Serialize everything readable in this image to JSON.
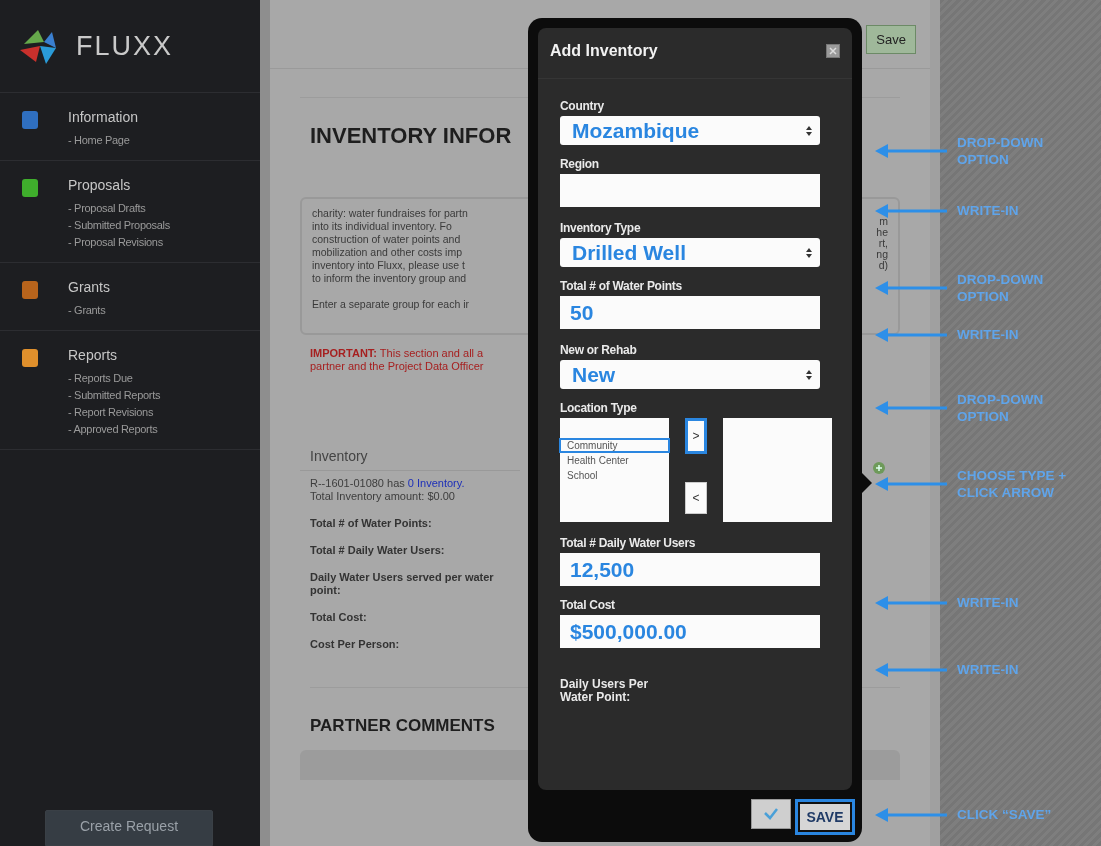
{
  "sidebar": {
    "logo_text": "FLUXX",
    "sections": [
      {
        "title": "Information",
        "color": "#2f6fc0",
        "items": [
          "- Home Page"
        ]
      },
      {
        "title": "Proposals",
        "color": "#3fae2c",
        "items": [
          "- Proposal Drafts",
          "- Submitted Proposals",
          "- Proposal Revisions"
        ]
      },
      {
        "title": "Grants",
        "color": "#b8641c",
        "items": [
          "- Grants"
        ]
      },
      {
        "title": "Reports",
        "color": "#e0902c",
        "items": [
          "- Reports Due",
          "- Submitted Reports",
          "- Report Revisions",
          "- Approved Reports"
        ]
      }
    ],
    "create_button": "Create Request"
  },
  "main": {
    "save_button": "Save",
    "heading": "INVENTORY INFOR",
    "intro_lines": [
      "charity: water fundraises for partn",
      "into its individual inventory. Fo",
      "construction of water points and",
      "mobilization and other costs imp",
      "inventory into Fluxx, please use t",
      "to inform the inventory group and"
    ],
    "intro_last": "Enter a separate group for each ir",
    "intro_edge": [
      "m",
      "he",
      "rt,",
      "ng",
      "d)"
    ],
    "important_lines": [
      "**IMPORTANT:** This section and all a",
      "partner and the Project Data Officer"
    ],
    "inventory_header": "Inventory",
    "record_text": "R--1601-01080 has",
    "record_link": "0 Inventory.",
    "amount_text": "Total Inventory amount: $0.00",
    "summary_labels": [
      "Total # of Water Points:",
      "Total # Daily Water Users:",
      "Daily Water Users served per water point:",
      "Total Cost:",
      "Cost Per Person:"
    ],
    "comments_heading": "PARTNER COMMENTS"
  },
  "modal": {
    "title": "Add Inventory",
    "fields": [
      {
        "kind": "select",
        "label": "Country",
        "value": "Mozambique"
      },
      {
        "kind": "text",
        "label": "Region"
      },
      {
        "kind": "select",
        "label": "Inventory Type",
        "value": "Drilled Well"
      },
      {
        "kind": "text",
        "label": "Total # of Water Points",
        "value": "50"
      },
      {
        "kind": "select",
        "label": "New or Rehab",
        "value": "New"
      },
      {
        "kind": "dual_list",
        "label": "Location Type",
        "options": [
          {
            "label": "Community",
            "selected": true
          },
          {
            "label": "Health Center",
            "selected": false
          },
          {
            "label": "School",
            "selected": false
          }
        ],
        "add_button": ">",
        "remove_button": "<"
      },
      {
        "kind": "text",
        "label": "Total # Daily Water Users",
        "value": "12,500"
      },
      {
        "kind": "text",
        "label": "Total Cost",
        "value": "$500,000.00"
      }
    ],
    "result_label": "Daily Users Per Water Point:",
    "save_button": "SAVE"
  },
  "annotations": [
    "DROP-DOWN OPTION",
    "WRITE-IN",
    "DROP-DOWN OPTION",
    "WRITE-IN",
    "DROP-DOWN OPTION",
    "CHOOSE TYPE + CLICK ARROW",
    "WRITE-IN",
    "WRITE-IN",
    "CLICK “SAVE”"
  ]
}
